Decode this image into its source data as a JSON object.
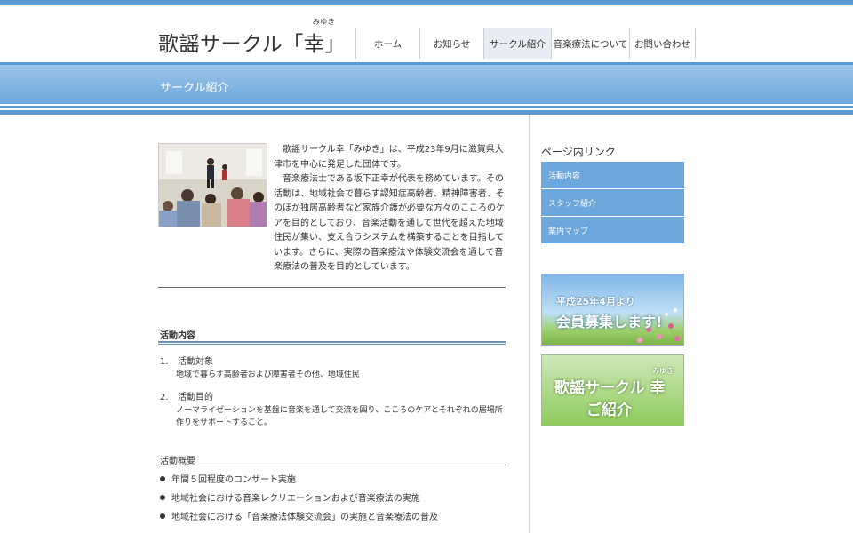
{
  "site": {
    "title_main": "歌謡サークル「",
    "title_kanji": "幸",
    "title_close": "」",
    "title_ruby": "みゆき"
  },
  "nav": {
    "items": [
      {
        "label": "ホーム"
      },
      {
        "label": "お知らせ"
      },
      {
        "label": "サークル紹介"
      },
      {
        "label": "音楽療法について"
      },
      {
        "label": "お問い合わせ"
      }
    ],
    "active": "サークル紹介"
  },
  "page": {
    "title": "サークル紹介"
  },
  "intro": {
    "para1": "歌謡サークル幸「みゆき」は、平成23年9月に滋賀県大津市を中心に発足した団体です。",
    "para2": "音楽療法士である坂下正幸が代表を務めています。その活動は、地域社会で暮らす認知症高齢者、精神障害者、そのほか独居高齢者など家族介護が必要な方々のこころのケアを目的としており、音楽活動を通して世代を超えた地域住民が集い、支え合うシステムを構築することを目指しています。さらに、実際の音楽療法や体験交流会を通して音楽療法の普及を目的としています。"
  },
  "activity": {
    "heading": "活動内容",
    "items": [
      {
        "num": "1.",
        "title": "活動対象",
        "desc": "地域で暮らす高齢者および障害者その他、地域住民"
      },
      {
        "num": "2.",
        "title": "活動目的",
        "desc": "ノーマライゼーションを基盤に音楽を通して交流を図り、こころのケアとそれぞれの居場所作りをサポートすること。"
      }
    ]
  },
  "summary": {
    "heading": "活動概要",
    "items": [
      "年間５回程度のコンサート実施",
      "地域社会における音楽レクリエーションおよび音楽療法の実施",
      "地域社会における「音楽療法体験交流会」の実施と音楽療法の普及"
    ]
  },
  "sidebar": {
    "title": "ページ内リンク",
    "links": [
      {
        "label": "活動内容"
      },
      {
        "label": "スタッフ紹介"
      },
      {
        "label": "案内マップ"
      }
    ],
    "banner1": {
      "line1": "平成25年4月より",
      "line2": "会員募集します!"
    },
    "banner2": {
      "line1": "歌謡サークル 幸",
      "ruby": "みゆき",
      "line2": "ご紹介"
    }
  },
  "colors": {
    "accent": "#5b9bd5",
    "band_gradient_top": "#9cc5ea",
    "band_gradient_bottom": "#6ba7dc",
    "side_link_bg": "#6ba7dc"
  }
}
